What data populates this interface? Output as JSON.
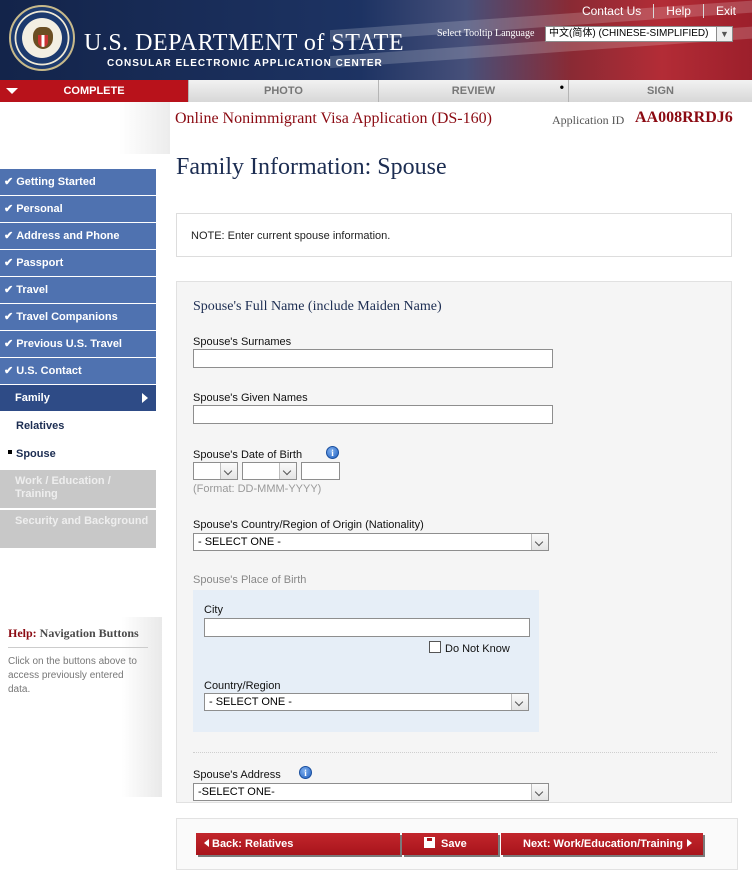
{
  "header": {
    "links": [
      "Contact Us",
      "Help",
      "Exit"
    ],
    "brand_title": "U.S. DEPARTMENT of STATE",
    "brand_subtitle": "CONSULAR ELECTRONIC APPLICATION CENTER",
    "tooltip_language_label": "Select Tooltip Language",
    "tooltip_language_value": "中文(简体)  (CHINESE-SIMPLIFIED)"
  },
  "steps": [
    "COMPLETE",
    "PHOTO",
    "REVIEW",
    "SIGN"
  ],
  "subheader": {
    "app_title": "Online Nonimmigrant Visa Application (DS-160)",
    "app_id_label": "Application ID",
    "app_id": "AA008RRDJ6"
  },
  "page_title": "Family Information: Spouse",
  "sidebar": {
    "completed": [
      "Getting Started",
      "Personal",
      "Address and Phone",
      "Passport",
      "Travel",
      "Travel Companions",
      "Previous U.S. Travel",
      "U.S. Contact"
    ],
    "current": "Family",
    "sub_items": [
      "Relatives",
      "Spouse"
    ],
    "disabled": [
      "Work / Education / Training",
      "Security and Background"
    ]
  },
  "help": {
    "prefix": "Help:",
    "title": "Navigation Buttons",
    "text": "Click on the buttons above to access previously entered data."
  },
  "note": "NOTE: Enter current spouse information.",
  "form": {
    "section_title": "Spouse's Full Name (include Maiden Name)",
    "surnames_label": "Spouse's Surnames",
    "given_names_label": "Spouse's Given Names",
    "dob_label": "Spouse's Date of Birth",
    "dob_format": "(Format: DD-MMM-YYYY)",
    "nationality_label": "Spouse's Country/Region of Origin (Nationality)",
    "nationality_value": "- SELECT ONE -",
    "pob_label": "Spouse's Place of Birth",
    "city_label": "City",
    "do_not_know_label": "Do Not Know",
    "country_label": "Country/Region",
    "country_value": "- SELECT ONE -",
    "address_label": "Spouse's Address",
    "address_value": "-SELECT ONE-"
  },
  "buttons": {
    "back": "Back: Relatives",
    "save": "Save",
    "next": "Next: Work/Education/Training"
  },
  "colors": {
    "brand_red": "#b8121b",
    "nav_blue": "#4f72b0",
    "title_navy": "#1c2d52"
  }
}
